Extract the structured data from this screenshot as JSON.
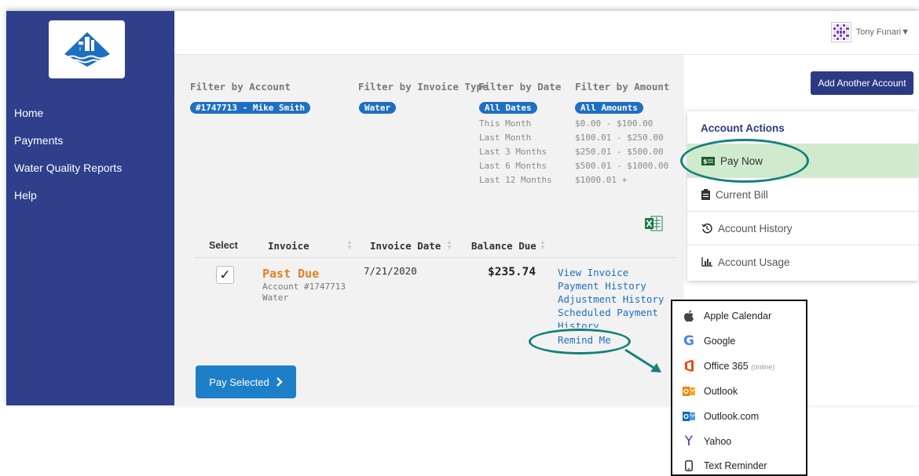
{
  "user": {
    "name": "Tony Funari▼"
  },
  "nav": {
    "items": [
      {
        "label": "Home"
      },
      {
        "label": "Payments"
      },
      {
        "label": "Water Quality Reports"
      },
      {
        "label": "Help"
      }
    ]
  },
  "filters": {
    "account": {
      "heading": "Filter by Account",
      "selected": "#1747713 - Mike Smith"
    },
    "invoice_type": {
      "heading": "Filter by Invoice Type",
      "selected": "Water"
    },
    "date": {
      "heading": "Filter by Date",
      "selected": "All Dates",
      "options": [
        "This Month",
        "Last Month",
        "Last 3 Months",
        "Last 6 Months",
        "Last 12 Months"
      ]
    },
    "amount": {
      "heading": "Filter by Amount",
      "selected": "All Amounts",
      "options": [
        "$0.00 - $100.00",
        "$100.01 - $250.00",
        "$250.01 - $500.00",
        "$500.01 - $1000.00",
        "$1000.01 +"
      ]
    }
  },
  "table": {
    "headers": {
      "select": "Select",
      "invoice": "Invoice",
      "invoice_date": "Invoice Date",
      "balance_due": "Balance Due"
    },
    "row": {
      "status": "Past Due",
      "account": "Account #1747713",
      "type": "Water",
      "date": "7/21/2020",
      "balance": "$235.74",
      "links": [
        "View Invoice",
        "Payment History",
        "Adjustment History",
        "Scheduled Payment",
        "History",
        "Remind Me"
      ]
    }
  },
  "pay_selected": {
    "label": "Pay Selected"
  },
  "right": {
    "add_account": "Add Another Account",
    "actions_title": "Account Actions",
    "actions": [
      {
        "label": "Pay Now",
        "icon": "money-icon"
      },
      {
        "label": "Current Bill",
        "icon": "bill-icon"
      },
      {
        "label": "Account History",
        "icon": "history-icon"
      },
      {
        "label": "Account Usage",
        "icon": "chart-icon"
      }
    ]
  },
  "calendar_menu": {
    "items": [
      {
        "label": "Apple Calendar",
        "icon": "apple-icon"
      },
      {
        "label": "Google",
        "icon": "google-icon"
      },
      {
        "label": "Office 365",
        "sub": "(online)",
        "icon": "office-icon"
      },
      {
        "label": "Outlook",
        "icon": "outlook-icon"
      },
      {
        "label": "Outlook.com",
        "icon": "outlook-com-icon"
      },
      {
        "label": "Yahoo",
        "icon": "yahoo-icon"
      },
      {
        "label": "Text Reminder",
        "icon": "phone-icon"
      }
    ]
  },
  "colors": {
    "sidebar": "#2f3f8c",
    "accent_blue": "#1e6fc2",
    "annotation_teal": "#16817a",
    "past_due": "#e67e22",
    "pay_now_bg": "#cfeacc"
  }
}
